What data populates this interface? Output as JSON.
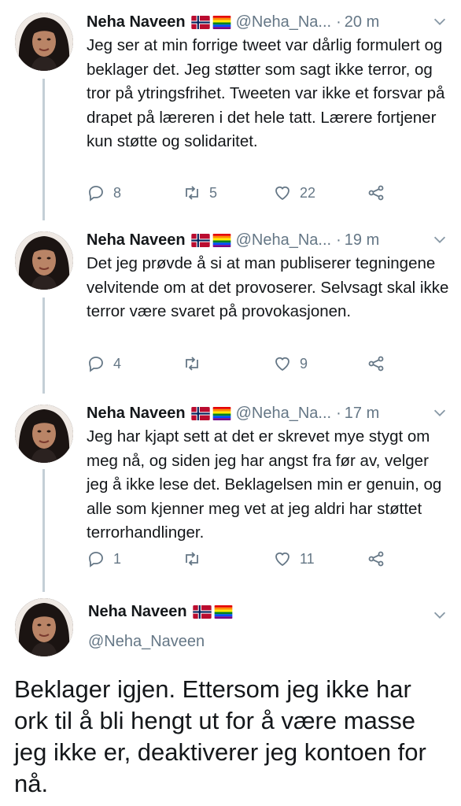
{
  "colors": {
    "text": "#14171a",
    "muted": "#657786",
    "thread": "#c4cfd6",
    "divider": "#e1e8ed"
  },
  "tweets": [
    {
      "name": "Neha Naveen",
      "handle": "@Neha_Na...",
      "time": "20 m",
      "text": "Jeg ser at min forrige tweet var dårlig formulert og beklager det. Jeg støtter som sagt ikke terror, og tror på ytringsfrihet. Tweeten var ikke et forsvar på drapet på læreren i det hele tatt. Lærere fortjener kun støtte og solidaritet.",
      "replies": "8",
      "retweets": "5",
      "likes": "22"
    },
    {
      "name": "Neha Naveen",
      "handle": "@Neha_Na...",
      "time": "19 m",
      "text": "Det jeg prøvde å si at man publiserer tegningene velvitende om at det provoserer. Selvsagt skal ikke terror være svaret på provokasjonen.",
      "replies": "4",
      "retweets": "",
      "likes": "9"
    },
    {
      "name": "Neha Naveen",
      "handle": "@Neha_Na...",
      "time": "17 m",
      "text": "Jeg har kjapt sett at det er skrevet mye stygt om meg nå, og siden jeg har angst fra før av, velger jeg å ikke lese det. Beklagelsen min er genuin, og alle som kjenner meg vet at jeg aldri har støttet terrorhandlinger.",
      "replies": "1",
      "retweets": "",
      "likes": "11"
    }
  ],
  "focused": {
    "name": "Neha Naveen",
    "handle": "@Neha_Naveen",
    "text": "Beklager igjen. Ettersom jeg ikke har ork til å bli hengt ut for å være masse jeg ikke er, deaktiverer jeg kontoen for nå."
  },
  "icons": [
    "reply-icon",
    "retweet-icon",
    "like-icon",
    "share-icon",
    "chevron-down-icon",
    "norway-flag-icon",
    "rainbow-flag-icon"
  ]
}
